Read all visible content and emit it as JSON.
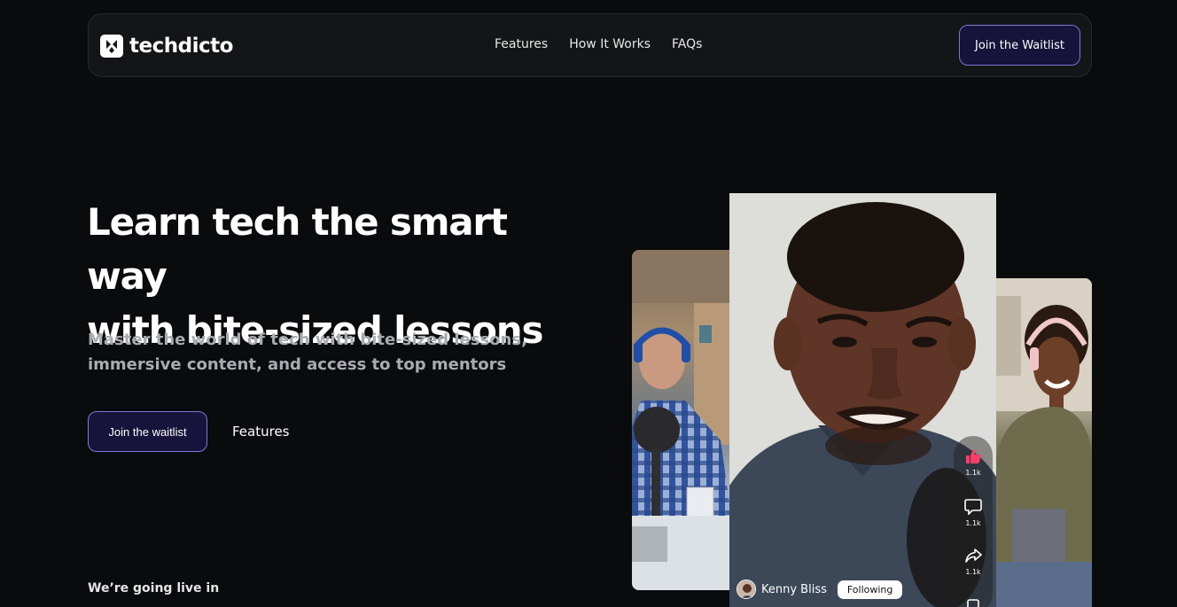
{
  "brand": {
    "name": "techdicto"
  },
  "nav": {
    "links": [
      "Features",
      "How It Works",
      "FAQs"
    ],
    "cta": "Join the Waitlist"
  },
  "hero": {
    "title_line1": "Learn tech the smart way",
    "title_line2": "with bite-sized lessons",
    "subtitle_line1": "Master the world of tech with bite-sized lessons,",
    "subtitle_line2": "immersive content, and access to top mentors",
    "primary_cta": "Join the waitlist",
    "secondary_cta": "Features",
    "live_label": "We’re going live in"
  },
  "video": {
    "creator_name": "Kenny Bliss",
    "follow_label": "Following",
    "like_count": "1.1k",
    "comment_count": "1.1k",
    "share_count": "1.1k",
    "like_color": "#ff3d6a"
  },
  "colors": {
    "background": "#0a0b0d",
    "nav_bg": "#141516",
    "cta_bg": "#17133a",
    "cta_border": "#7d78d6"
  }
}
